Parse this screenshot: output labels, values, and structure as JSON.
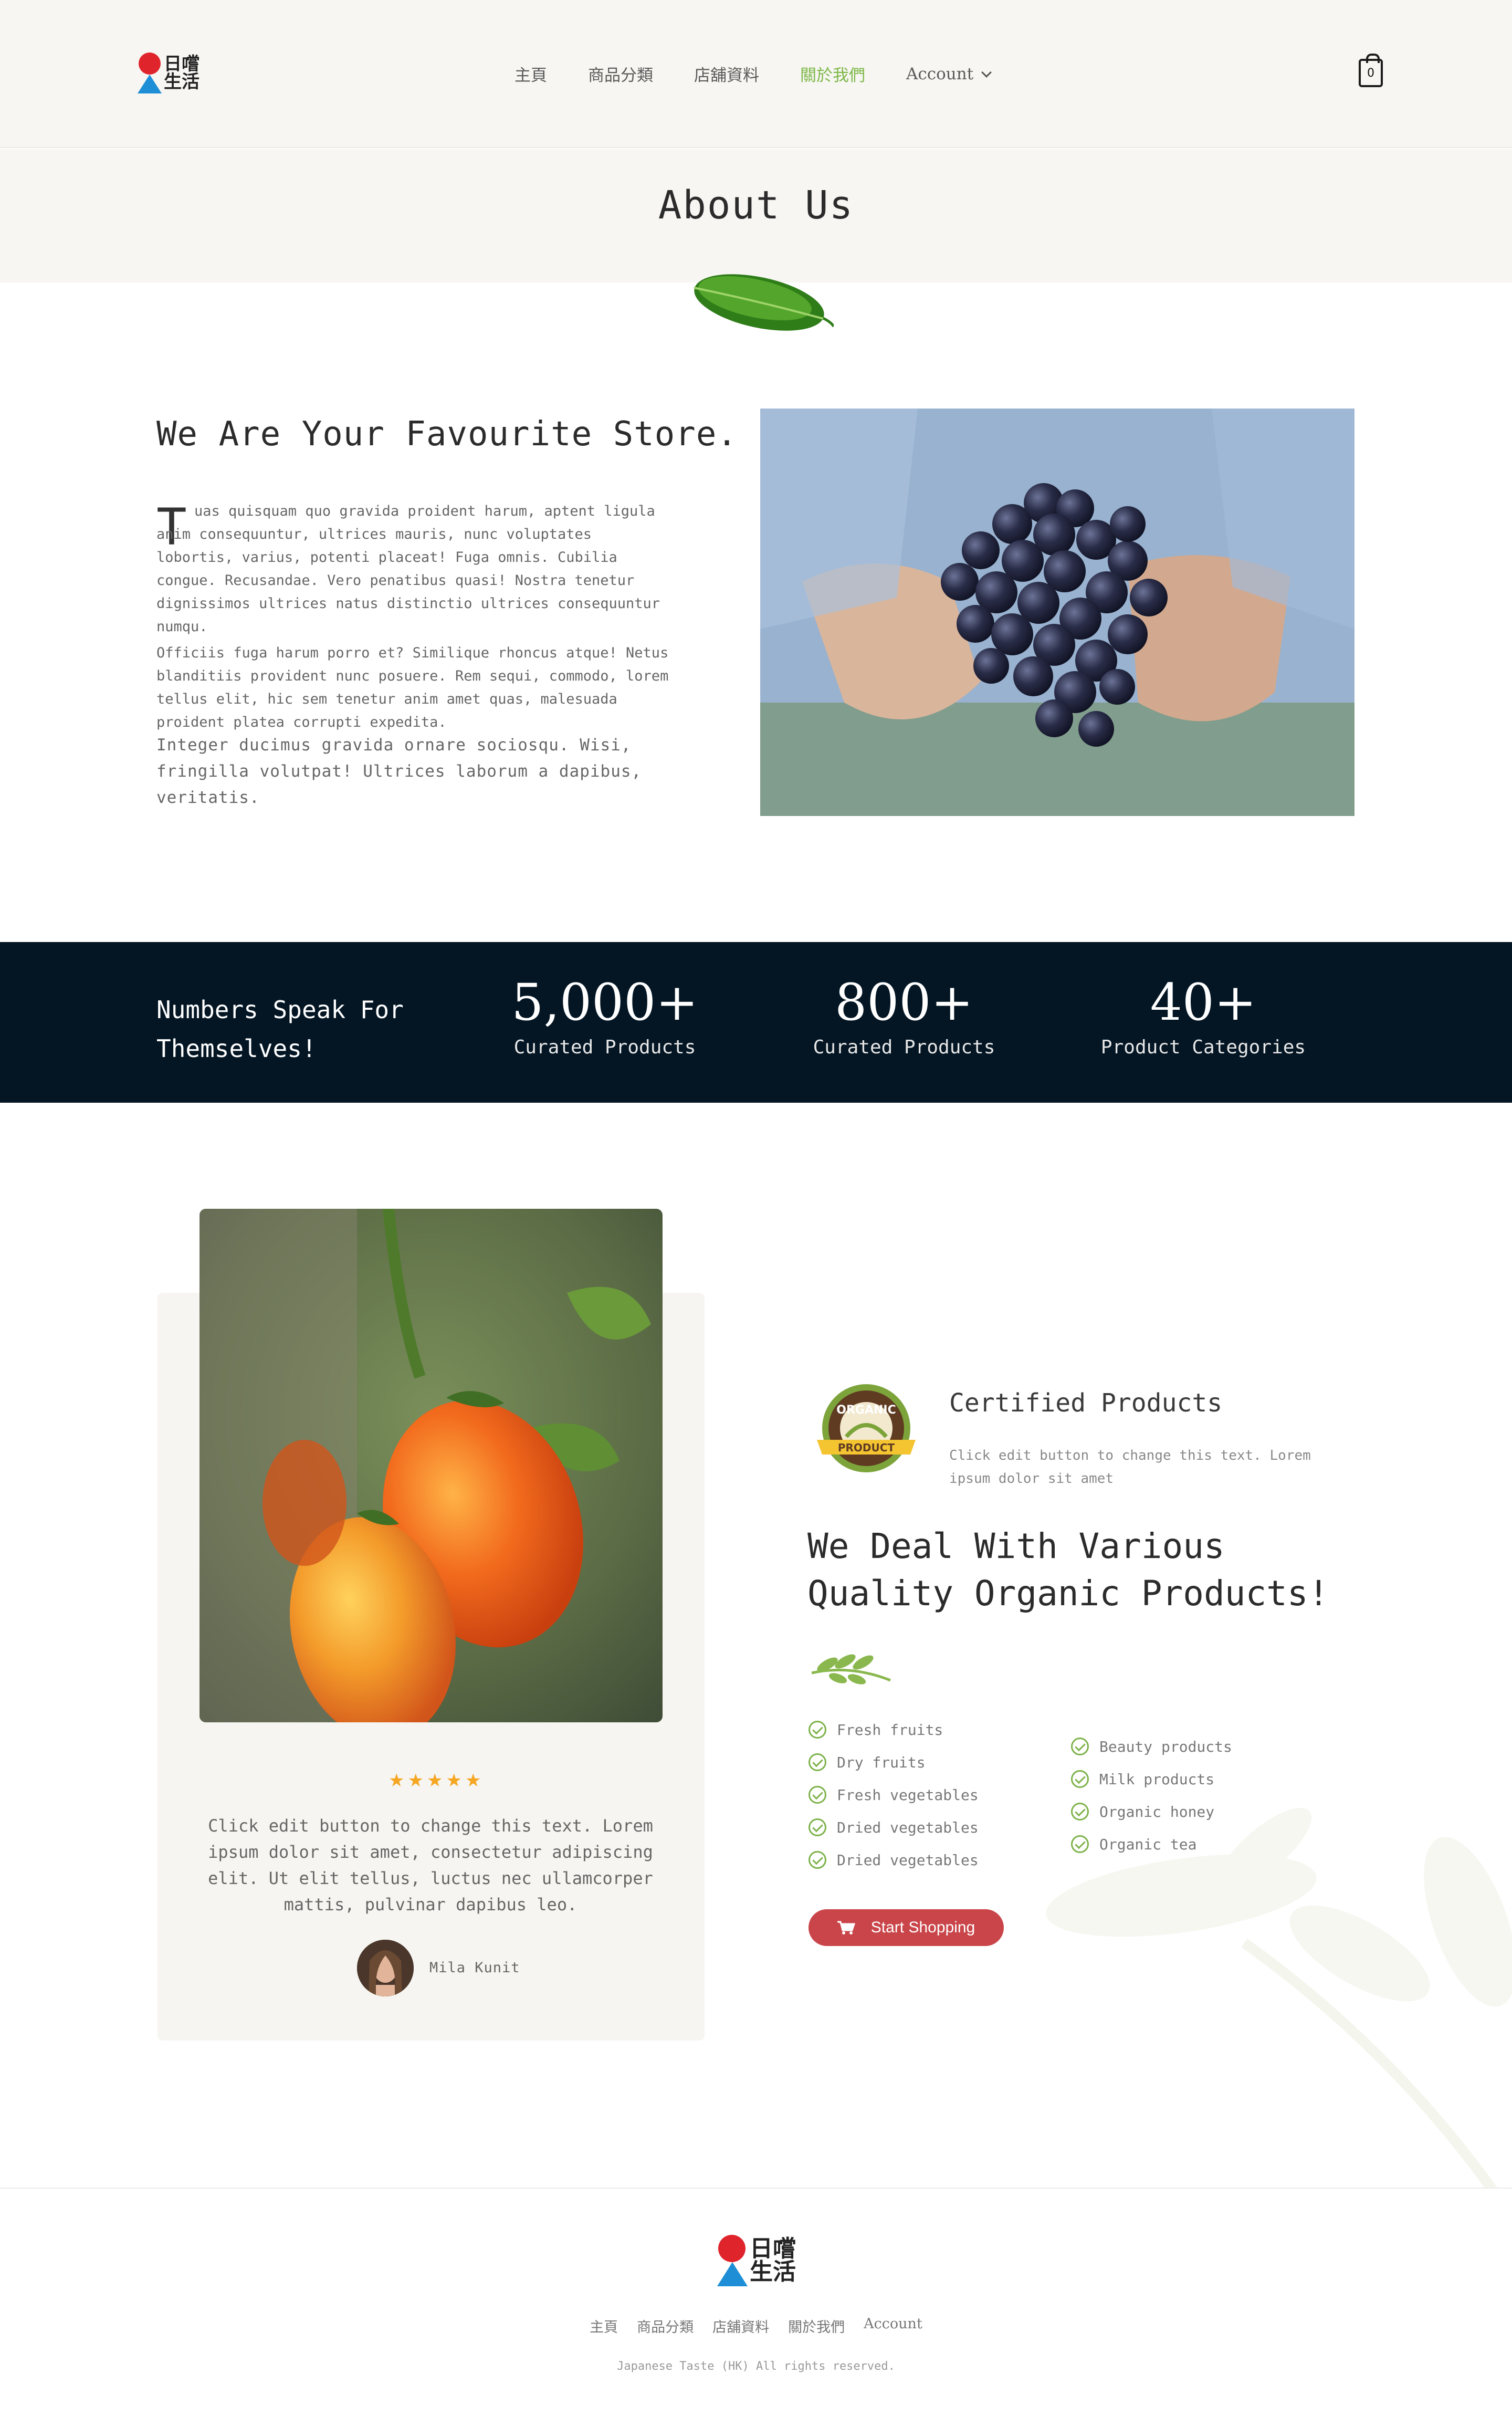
{
  "header": {
    "logo": {
      "line1": "日嚐",
      "line2": "生活"
    },
    "nav": [
      {
        "label": "主頁"
      },
      {
        "label": "商品分類"
      },
      {
        "label": "店舖資料"
      },
      {
        "label": "關於我們",
        "active": true
      },
      {
        "label": "Account"
      }
    ],
    "cart_count": "0"
  },
  "hero": {
    "title": "About Us"
  },
  "about": {
    "title": "We Are Your Favourite Store.",
    "drop_cap": "T",
    "paragraph1": "uas quisquam quo gravida proident harum, aptent ligula anim consequuntur, ultrices mauris, nunc voluptates lobortis, varius, potenti placeat! Fuga omnis. Cubilia congue. Recusandae. Vero penatibus quasi! Nostra tenetur dignissimos ultrices natus distinctio ultrices consequuntur numqu.",
    "paragraph2": "Officiis fuga harum porro et? Similique rhoncus atque! Netus blanditiis provident nunc posuere. Rem sequi, commodo, lorem tellus elit, hic sem tenetur anim amet quas, malesuada proident platea corrupti expedita.",
    "paragraph3": "Integer ducimus gravida ornare sociosqu. Wisi, fringilla volutpat! Ultrices laborum a dapibus, veritatis."
  },
  "stats": {
    "lead_line1": "Numbers Speak For",
    "lead_line2": "Themselves!",
    "items": [
      {
        "number": "5,000+",
        "label": "Curated Products"
      },
      {
        "number": "800+",
        "label": "Curated Products"
      },
      {
        "number": "40+",
        "label": "Product Categories"
      }
    ]
  },
  "testimonial": {
    "rating": 5,
    "quote": "Click edit button to change this text. Lorem ipsum dolor sit amet, consectetur adipiscing elit. Ut elit tellus, luctus nec ullamcorper mattis, pulvinar dapibus leo.",
    "author": "Mila Kunit"
  },
  "certified": {
    "badge_top": "ORGANIC",
    "badge_bottom": "PRODUCT",
    "title": "Certified Products",
    "desc": "Click edit button to change this text. Lorem ipsum dolor sit amet"
  },
  "deal": {
    "title": "We Deal With Various Quality Organic Products!",
    "list_left": [
      "Fresh fruits",
      "Dry fruits",
      "Fresh vegetables",
      "Dried vegetables",
      "Dried vegetables"
    ],
    "list_right": [
      "Beauty products",
      "Milk products",
      "Organic honey",
      "Organic tea"
    ],
    "button": "Start Shopping"
  },
  "footer": {
    "logo": {
      "line1": "日嚐",
      "line2": "生活"
    },
    "nav": [
      "主頁",
      "商品分類",
      "店舖資料",
      "關於我們",
      "Account"
    ],
    "copyright": "Japanese Taste (HK) All rights reserved."
  },
  "colors": {
    "accent_green": "#7fb84a",
    "dark_band": "#041624",
    "button_red": "#c94549",
    "star": "#f5a623",
    "page_bg_light": "#f7f6f2"
  }
}
